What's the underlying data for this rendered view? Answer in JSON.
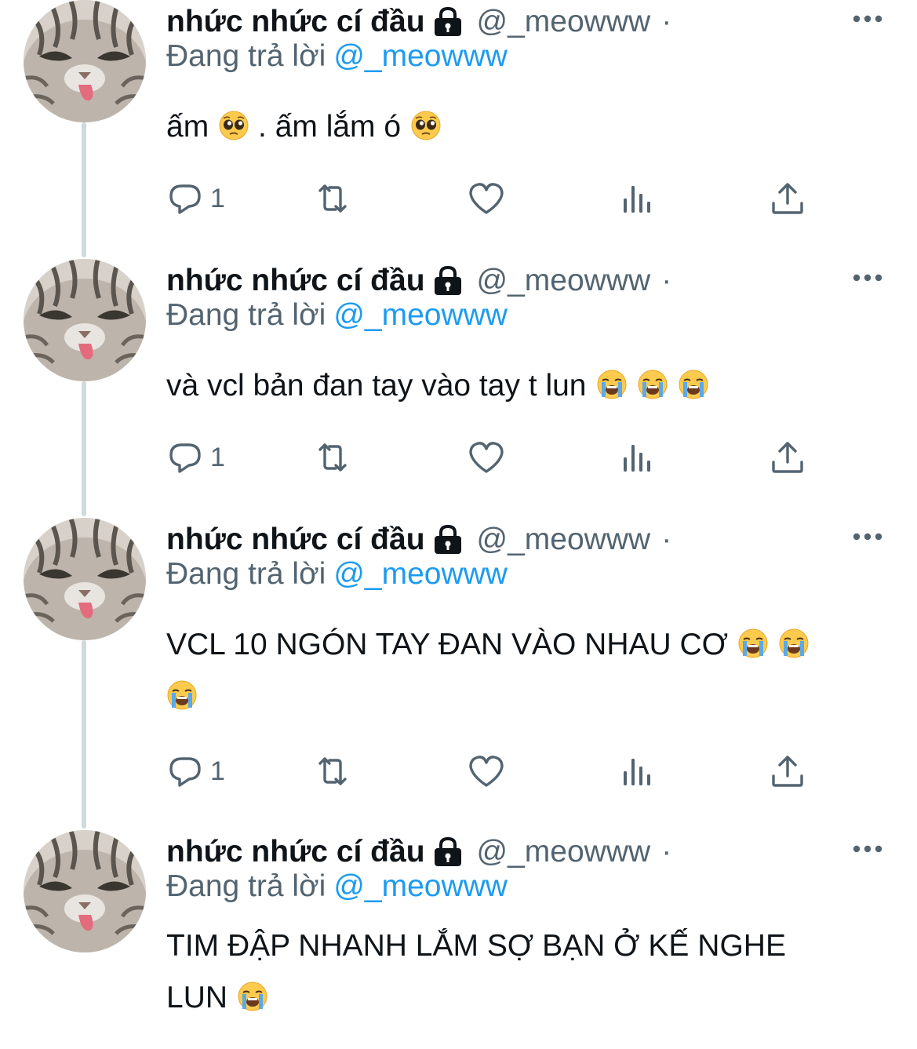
{
  "author": {
    "name": "nhức nhức cí đầu",
    "handle": "@_meowww",
    "separator": "·",
    "protected_icon": "lock-icon"
  },
  "reply_label": {
    "prefix": "Đang trả lời",
    "mention": "@_meowww"
  },
  "colors": {
    "accent": "#1d9bf0",
    "secondary_text": "#536471",
    "thread_line": "#cfd9de"
  },
  "tweets": [
    {
      "text": "ấm 🥺 . ấm lắm ó 🥺",
      "parts": [
        "ấm",
        " . ấm lắm ó"
      ],
      "emoji": "pleading-face",
      "reply_count": "1"
    },
    {
      "text": "và vcl bản đan tay vào tay t lun 😭 😭 😭",
      "parts": [
        "và vcl bản đan tay vào tay t lun"
      ],
      "emoji": "loudly-crying-face",
      "reply_count": "1"
    },
    {
      "text": "VCL 10 NGÓN TAY ĐAN VÀO NHAU CƠ 😭 😭 😭",
      "parts": [
        "VCL 10 NGÓN TAY ĐAN VÀO NHAU CƠ"
      ],
      "emoji": "loudly-crying-face",
      "reply_count": "1"
    },
    {
      "text": "TIM ĐẬP NHANH LẮM SỢ BẠN Ở KẾ NGHE LUN 😭",
      "parts": [
        "TIM ĐẬP NHANH LẮM SỢ BẠN Ở KẾ NGHE",
        "LUN"
      ],
      "emoji": "loudly-crying-face"
    }
  ],
  "action_icons": [
    "reply-icon",
    "retweet-icon",
    "like-icon",
    "analytics-icon",
    "share-icon"
  ]
}
